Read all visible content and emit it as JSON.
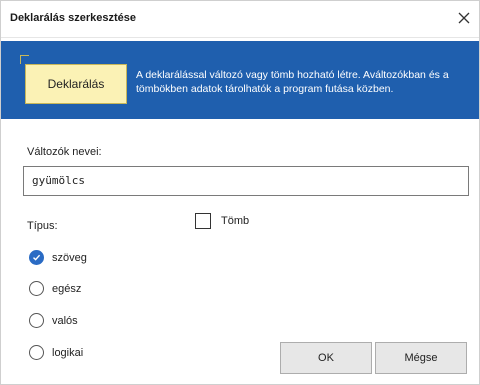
{
  "window": {
    "title": "Deklarálás szerkesztése",
    "close_icon": "close-icon"
  },
  "banner": {
    "badge_label": "Deklarálás",
    "description": "A deklarálással változó vagy tömb hozható létre. Aváltozókban és a tömbökben adatok tárolhatók a program futása közben.",
    "background_color": "#1f5fae",
    "badge_color": "#fbf2b5"
  },
  "variables": {
    "label": "Változók nevei:",
    "value": "gyümölcs"
  },
  "type": {
    "label": "Típus:",
    "array_checkbox": {
      "label": "Tömb",
      "checked": false
    },
    "options": [
      {
        "label": "szöveg",
        "checked": true
      },
      {
        "label": "egész",
        "checked": false
      },
      {
        "label": "valós",
        "checked": false
      },
      {
        "label": "logikai",
        "checked": false
      }
    ],
    "selected_color": "#2a6bc4"
  },
  "buttons": {
    "ok_label": "OK",
    "cancel_label": "Mégse"
  }
}
